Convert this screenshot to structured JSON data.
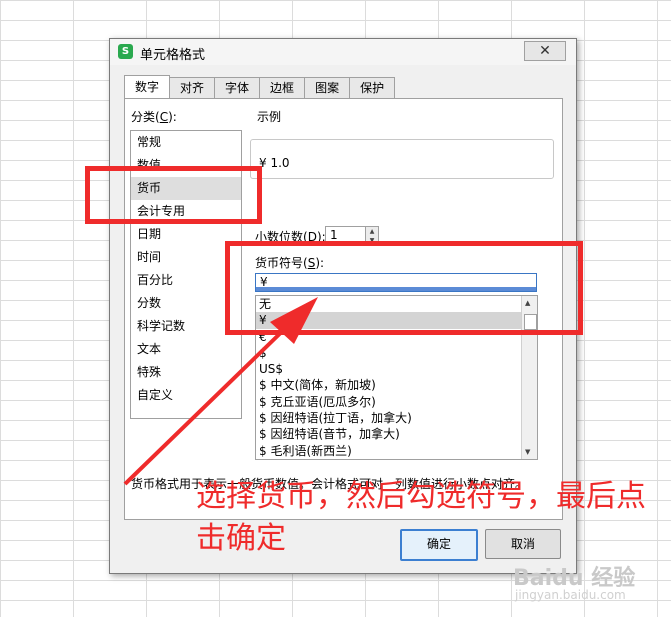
{
  "dialog": {
    "title": "单元格格式",
    "app_icon": "S",
    "close_label": "✕",
    "tabs": [
      "数字",
      "对齐",
      "字体",
      "边框",
      "图案",
      "保护"
    ],
    "category_label": "分类(",
    "category_key": "C",
    "category_suffix": "):",
    "categories": [
      "常规",
      "数值",
      "货币",
      "会计专用",
      "日期",
      "时间",
      "百分比",
      "分数",
      "科学记数",
      "文本",
      "特殊",
      "自定义"
    ],
    "selected_category": "货币",
    "example_label": "示例",
    "example_value": "¥ 1.0",
    "decimal_label_pre": "小数位数(",
    "decimal_key": "D",
    "decimal_label_post": "):",
    "decimal_value": "1",
    "symbol_label_pre": "货币符号(",
    "symbol_key": "S",
    "symbol_label_post": "):",
    "symbol_selected": "¥",
    "symbols": [
      "无",
      "¥",
      "€",
      "$",
      "US$",
      "$ 中文(简体，新加坡)",
      "$ 克丘亚语(厄瓜多尔)",
      "$ 因纽特语(拉丁语，加拿大)",
      "$ 因纽特语(音节，加拿大)",
      "$ 毛利语(新西兰)"
    ],
    "description": "货币格式用于表示一般货币数值。会计格式可对一列数值进行小数点对齐。",
    "ok_label": "确定",
    "cancel_label": "取消"
  },
  "annotation": {
    "note": "选择货币，然后勾选符号，最后点击确定",
    "color": "#ef2b2b"
  },
  "watermark": {
    "brand": "Baidu 经验",
    "url": "jingyan.baidu.com"
  }
}
